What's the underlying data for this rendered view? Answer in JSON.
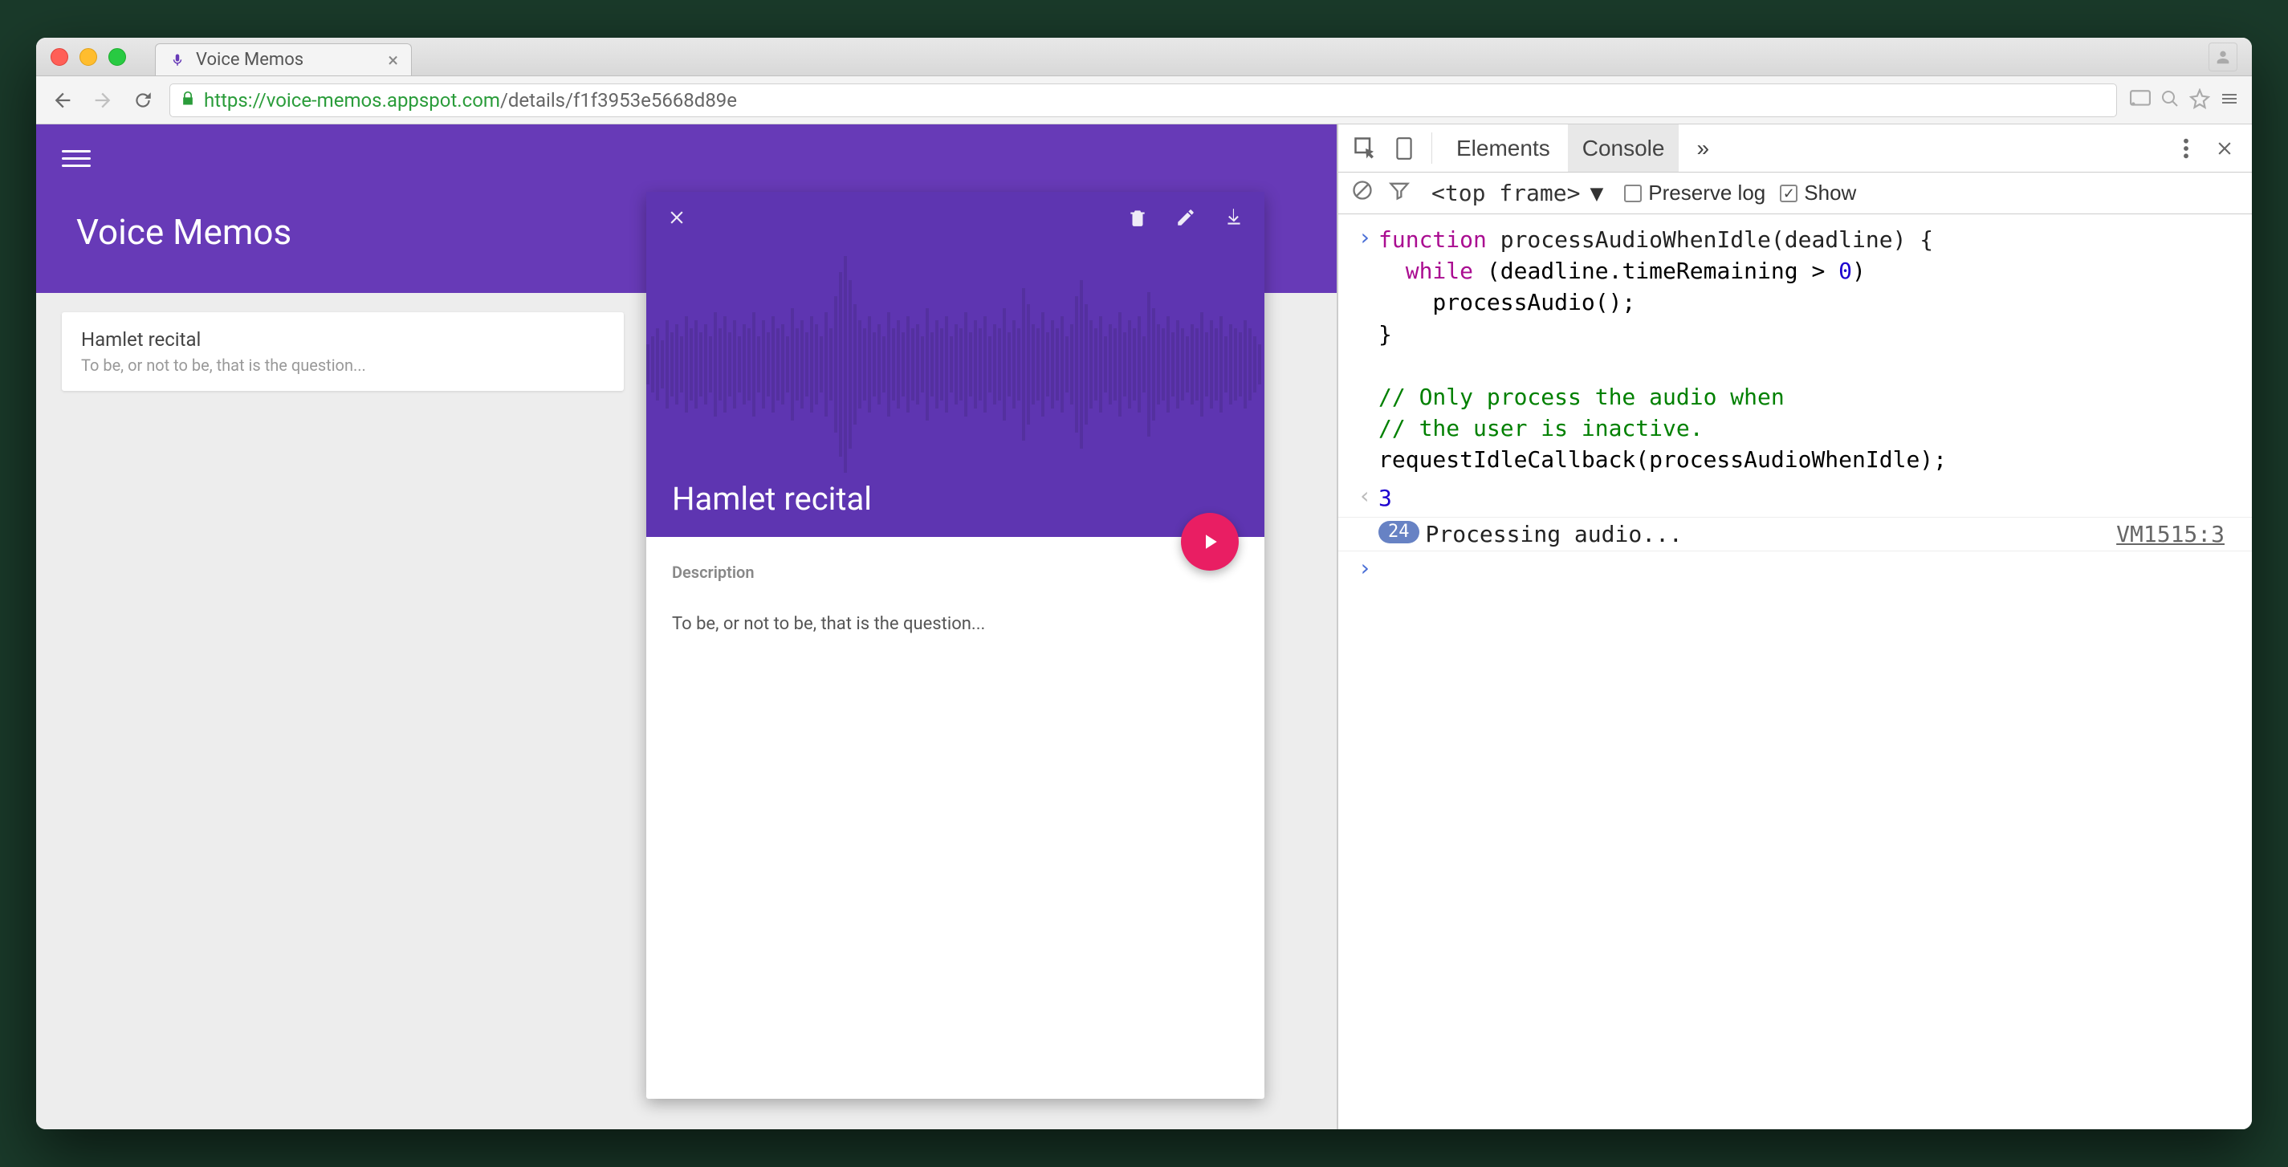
{
  "window": {
    "tab_title": "Voice Memos",
    "profile_tooltip": "Profile"
  },
  "nav": {
    "url_host": "https://voice-memos.appspot.com",
    "url_path": "/details/f1f3953e5668d89e"
  },
  "app": {
    "title": "Voice Memos",
    "list": [
      {
        "title": "Hamlet recital",
        "desc": "To be, or not to be, that is the question..."
      }
    ],
    "detail": {
      "title": "Hamlet recital",
      "description_label": "Description",
      "description": "To be, or not to be, that is the question..."
    }
  },
  "devtools": {
    "tabs": {
      "elements": "Elements",
      "console": "Console",
      "more": "»"
    },
    "filter": {
      "frame": "<top frame>",
      "preserve_log": "Preserve log",
      "preserve_checked": false,
      "show": "Show",
      "show_checked": true
    },
    "code": {
      "l1": "function processAudioWhenIdle(deadline) {",
      "l2": "  while (deadline.timeRemaining > 0)",
      "l3": "    processAudio();",
      "l4": "}",
      "l5": "",
      "l6": "// Only process the audio when",
      "l7": "// the user is inactive.",
      "l8": "requestIdleCallback(processAudioWhenIdle);"
    },
    "result": "3",
    "log": {
      "count": "24",
      "msg": "Processing audio...",
      "src": "VM1515:3"
    }
  }
}
